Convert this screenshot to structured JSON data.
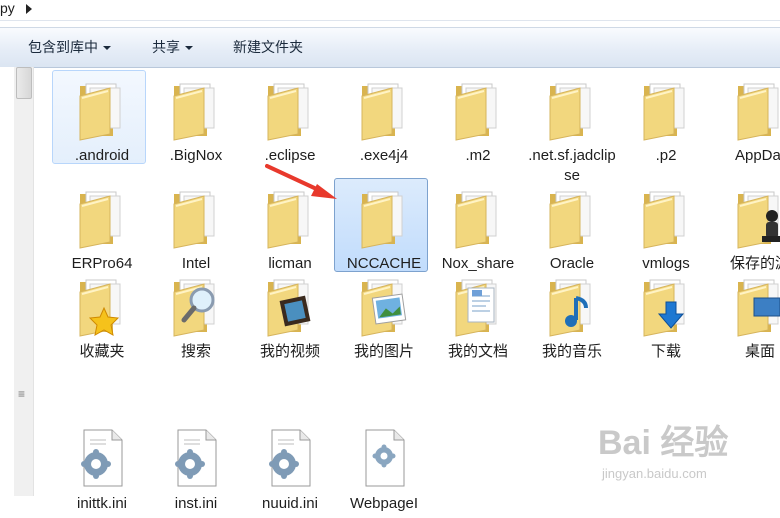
{
  "address": {
    "segment": "py"
  },
  "toolbar": {
    "buttons": [
      "包含到库中",
      "共享",
      "新建文件夹"
    ]
  },
  "files": [
    {
      "label": ".android",
      "icon": "folder-icon"
    },
    {
      "label": ".BigNox",
      "icon": "folder-icon"
    },
    {
      "label": ".eclipse",
      "icon": "folder-icon"
    },
    {
      "label": ".exe4j4",
      "icon": "folder-icon"
    },
    {
      "label": ".m2",
      "icon": "folder-icon"
    },
    {
      "label": ".net.sf.jadclipse",
      "icon": "folder-icon"
    },
    {
      "label": ".p2",
      "icon": "folder-icon"
    },
    {
      "label": "AppDat",
      "icon": "folder-icon"
    },
    {
      "label": "ERPro64",
      "icon": "folder-icon"
    },
    {
      "label": "Intel",
      "icon": "folder-icon"
    },
    {
      "label": "licman",
      "icon": "folder-icon"
    },
    {
      "label": "NCCACHE",
      "icon": "folder-icon"
    },
    {
      "label": "Nox_share",
      "icon": "folder-icon"
    },
    {
      "label": "Oracle",
      "icon": "folder-icon"
    },
    {
      "label": "vmlogs",
      "icon": "folder-icon"
    },
    {
      "label": "保存的游",
      "icon": "saved-games-folder-icon"
    },
    {
      "label": "收藏夹",
      "icon": "favorites-folder-icon"
    },
    {
      "label": "搜索",
      "icon": "searches-folder-icon"
    },
    {
      "label": "我的视频",
      "icon": "videos-folder-icon"
    },
    {
      "label": "我的图片",
      "icon": "pictures-folder-icon"
    },
    {
      "label": "我的文档",
      "icon": "documents-folder-icon"
    },
    {
      "label": "我的音乐",
      "icon": "music-folder-icon"
    },
    {
      "label": "下载",
      "icon": "downloads-folder-icon"
    },
    {
      "label": "桌面",
      "icon": "desktop-folder-icon"
    },
    {
      "label": "inittk.ini",
      "icon": "ini-file-icon"
    },
    {
      "label": "inst.ini",
      "icon": "ini-file-icon"
    },
    {
      "label": "nuuid.ini",
      "icon": "ini-file-icon"
    },
    {
      "label": "WebpageI",
      "icon": "config-file-icon"
    }
  ],
  "selected": "NCCACHE",
  "hovered": ".android",
  "watermark": {
    "brand": "Bai 经验",
    "url": "jingyan.baidu.com"
  },
  "colors": {
    "folder": "#f2d77e",
    "selection": "#c1dcfc",
    "arrow": "#e8392c"
  }
}
